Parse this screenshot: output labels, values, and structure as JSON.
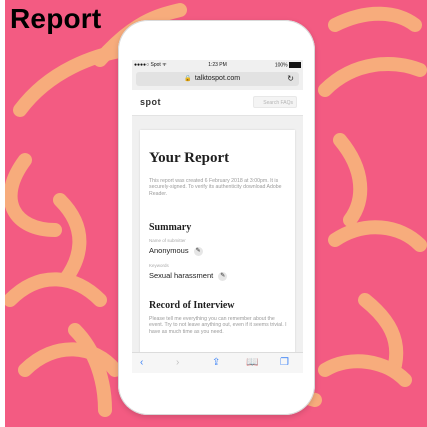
{
  "overlay": {
    "title": "Report"
  },
  "colors": {
    "background": "#f35b82",
    "brush": "#f8b17c",
    "accent": "#3b82f6"
  },
  "status_bar": {
    "carrier": "●●●●○ Spot ᯤ",
    "time": "1:23 PM",
    "battery": "100%"
  },
  "browser": {
    "url": "talktospot.com",
    "lock_icon": "lock-icon",
    "reload_icon": "reload-icon"
  },
  "site": {
    "logo": "spot",
    "search_placeholder": "Search FAQs"
  },
  "report": {
    "title": "Your Report",
    "description": "This report was created 6 February 2018 at 3:00pm. It is securely-signed. To verify its authenticity download Adobe Reader.",
    "summary_heading": "Summary",
    "submitter_label": "Name of submitter",
    "submitter_value": "Anonymous",
    "keywords_label": "Keywords",
    "keywords_value": "Sexual harassment",
    "record_heading": "Record of Interview",
    "record_text": "Please tell me everything you can remember about the event. Try to not leave anything out, even if it seems trivial. I have as much time as you need."
  },
  "toolbar": {
    "back_icon": "back-icon",
    "forward_icon": "forward-icon",
    "share_icon": "share-icon",
    "bookmarks_icon": "bookmarks-icon",
    "tabs_icon": "tabs-icon"
  }
}
